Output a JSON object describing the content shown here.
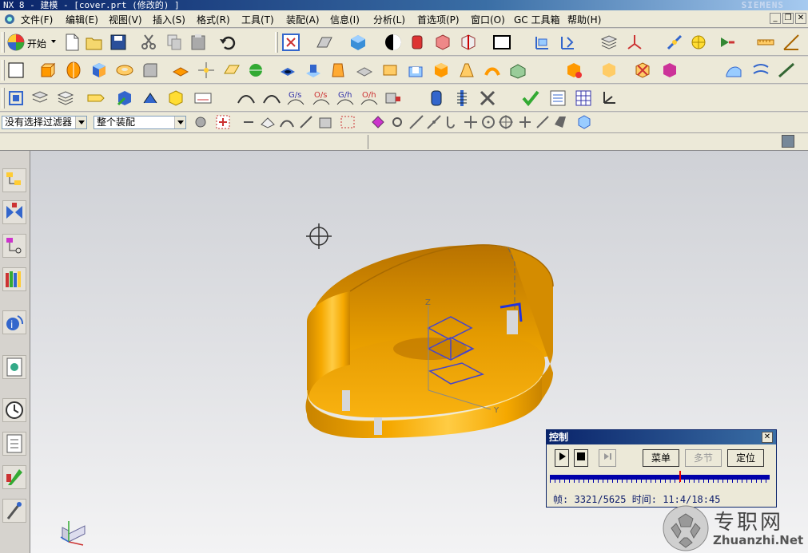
{
  "window": {
    "title": "NX 8 - 建模 - [cover.prt (修改的) ]",
    "brand": "SIEMENS"
  },
  "menu": {
    "items": [
      "文件(F)",
      "编辑(E)",
      "视图(V)",
      "插入(S)",
      "格式(R)",
      "工具(T)",
      "装配(A)",
      "信息(I)",
      "分析(L)",
      "首选项(P)",
      "窗口(O)",
      "GC 工具箱",
      "帮助(H)"
    ]
  },
  "toolbar": {
    "start_label": "开始"
  },
  "selection": {
    "filter": "没有选择过滤器",
    "scope": "整个装配"
  },
  "control_dialog": {
    "title": "控制",
    "menu_label": "菜单",
    "step_label": "多节",
    "locate_label": "定位",
    "frame_label": "帧:",
    "frame_value": "3321/5625",
    "time_label": "时间:",
    "time_value": "11:4/18:45",
    "progress": 0.59
  },
  "model": {
    "axis_z": "Z",
    "axis_y": "Y",
    "body_color": "#f5a800"
  },
  "watermark": {
    "cn": "专职网",
    "en": "Zhuanzhi.Net"
  },
  "icons": [
    "nx-logo-icon",
    "new-icon",
    "open-icon",
    "save-icon",
    "cut-icon",
    "copy-icon",
    "paste-icon",
    "undo-icon",
    "fit-view-icon",
    "shaded-icon",
    "wireframe-icon",
    "clock-icon",
    "sketch-icon",
    "block-icon",
    "cylinder-icon",
    "extrude-icon",
    "measure-icon"
  ]
}
